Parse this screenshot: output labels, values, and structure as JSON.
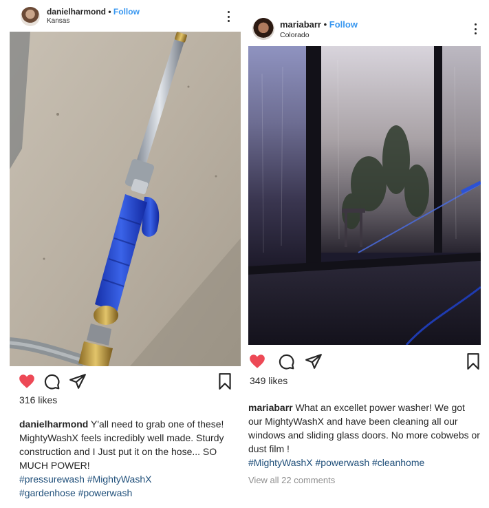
{
  "post1": {
    "username": "danielharmond",
    "separator": "•",
    "follow_label": "Follow",
    "location": "Kansas",
    "likes": "316 likes",
    "caption_user": "danielharmond",
    "caption_text": "Y'all need to grab one of these! MightyWashX feels incredibly well made. Sturdy construction and I Just put it on the hose... SO MUCH POWER!",
    "hashtags_line1": "#pressurewash #MightyWashX",
    "hashtags_line2": "#gardenhose #powerwash",
    "icons": [
      "heart-filled-icon",
      "comment-icon",
      "share-icon",
      "bookmark-icon"
    ],
    "like_color": "#ed4956"
  },
  "post2": {
    "username": "mariabarr",
    "separator": "•",
    "follow_label": "Follow",
    "location": "Colorado",
    "likes": "349 likes",
    "caption_user": "mariabarr",
    "caption_text": "What an excellet power washer! We got our MightyWashX and have been cleaning all our windows and sliding glass doors. No more cobwebs or dust film !",
    "hashtags": "#MightyWashX #powerwash #cleanhome",
    "view_comments": "View all 22 comments",
    "icons": [
      "heart-filled-icon",
      "comment-icon",
      "share-icon",
      "bookmark-icon"
    ],
    "like_color": "#ed4956"
  },
  "colors": {
    "follow": "#3897f0",
    "hashtag": "#1e4e79",
    "muted": "#8e8e8e",
    "text": "#262626"
  }
}
